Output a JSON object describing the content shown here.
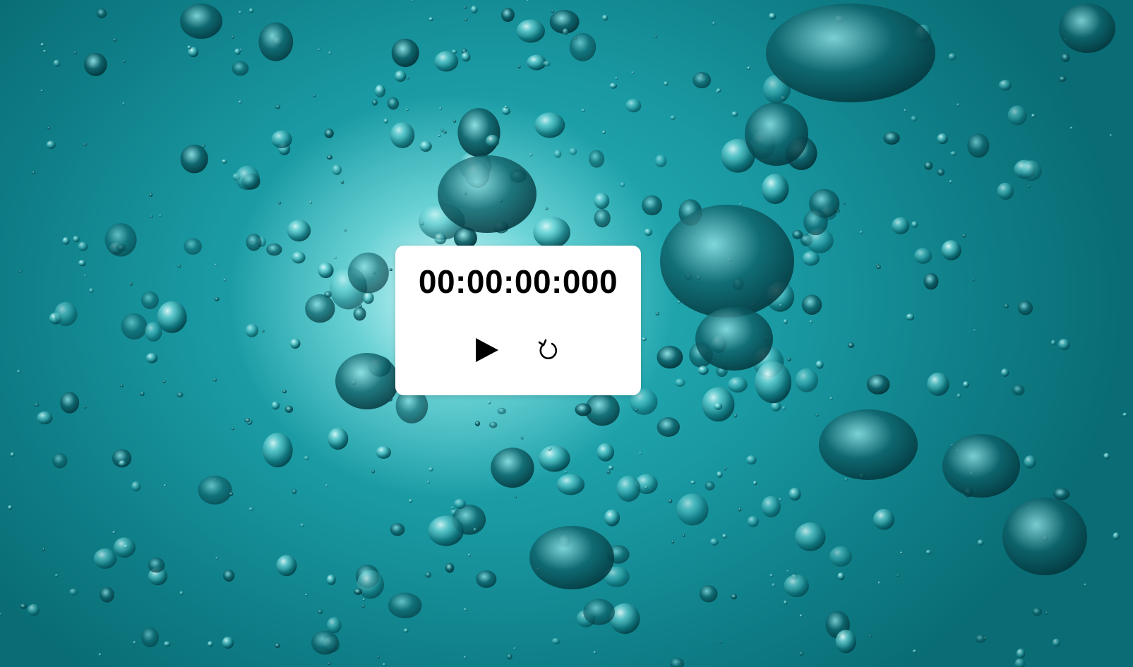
{
  "stopwatch": {
    "time_display": "00:00:00:000"
  },
  "controls": {
    "play_icon": "play-icon",
    "reset_icon": "reset-icon"
  },
  "background": {
    "description_icon": "underwater-bubbles-image",
    "colors": [
      "#0a6c74",
      "#1a9aa3",
      "#2bb7bd",
      "#e6ffff"
    ]
  }
}
